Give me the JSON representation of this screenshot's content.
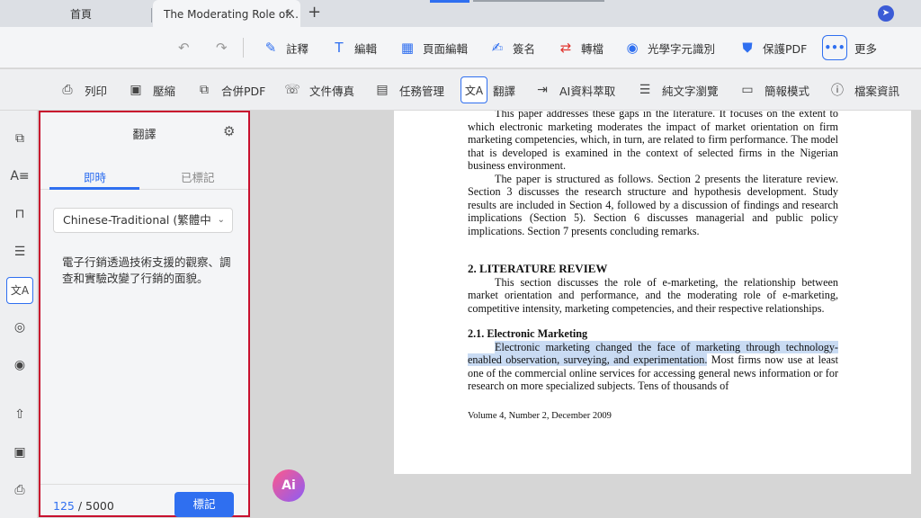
{
  "tabs": {
    "home": "首頁",
    "doc": "The Moderating Role of...",
    "close": "✕",
    "add": "+"
  },
  "toolbar1": {
    "undo": "↶",
    "redo": "↷",
    "annotate": "註釋",
    "edit": "編輯",
    "page_edit": "頁面編輯",
    "sign": "簽名",
    "convert": "轉檔",
    "ocr": "光學字元識別",
    "protect": "保護PDF",
    "more_dots": "•••",
    "more": "更多"
  },
  "toolbar2": {
    "print": "列印",
    "compress": "壓縮",
    "merge": "合併PDF",
    "fax": "文件傳真",
    "tasks": "任務管理",
    "translate": "翻譯",
    "ai_extract": "AI資料萃取",
    "plain_text": "純文字瀏覽",
    "presentation": "簡報模式",
    "file_info": "檔案資訊",
    "translate_icon": "文A"
  },
  "leftbar": {
    "translate_icon": "文A"
  },
  "panel": {
    "title": "翻譯",
    "tab_live": "即時",
    "tab_marked": "已標記",
    "language": "Chinese-Traditional (繁體中",
    "translation": "電子行銷透過技術支援的觀察、調查和實驗改變了行銷的面貌。",
    "count_current": "125",
    "count_sep": " / ",
    "count_max": "5000",
    "mark_button": "標記"
  },
  "ai_button": "Ai",
  "pdf": {
    "p1": "This paper addresses these gaps in the literature. It focuses on the extent to which electronic marketing moderates the impact of market orientation on firm marketing competencies, which, in turn, are related to firm performance. The model that is developed is examined in the context of selected firms in the Nigerian business environment.",
    "p2": "The paper is structured as follows. Section 2 presents the literature review. Section 3 discusses the research structure and hypothesis development. Study results are included in Section 4, followed by a discussion of findings and research implications (Section 5). Section 6 discusses managerial and public policy implications. Section 7 presents concluding remarks.",
    "h2": "2.    LITERATURE REVIEW",
    "p3": "This section discusses the role of e-marketing, the relationship between market orientation and performance, and the moderating role of e-marketing, competitive intensity, marketing competencies, and their respective relationships.",
    "h3": "2.1.  Electronic Marketing",
    "p4_highlight": "Electronic marketing changed the face of marketing through technology-enabled observation, surveying, and experimentation.",
    "p4_rest": " Most firms now use at least one of the commercial online services for accessing general news information or for research on more specialized subjects. Tens of thousands of",
    "footer": "Volume 4, Number 2, December 2009"
  }
}
